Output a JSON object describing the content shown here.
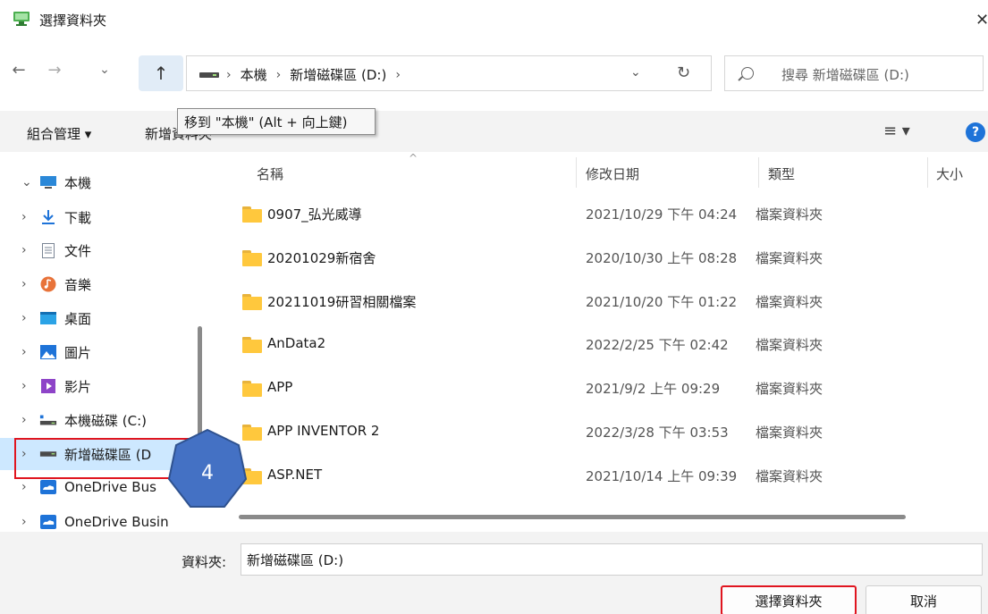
{
  "window": {
    "title": "選擇資料夾",
    "close": "✕"
  },
  "nav": {
    "back": "←",
    "forward": "→",
    "recent": "⌄",
    "up": "↑",
    "breadcrumb": [
      "本機",
      "新增磁碟區 (D:)"
    ],
    "refresh": "↻",
    "search_placeholder": "搜尋 新增磁碟區 (D:)"
  },
  "toolbar": {
    "organize": "組合管理 ▾",
    "new_folder": "新增資料夾",
    "view": "≡ ▾",
    "help": "?"
  },
  "tooltip": "移到 \"本機\" (Alt + 向上鍵)",
  "sidebar": {
    "items": [
      {
        "label": "本機",
        "chevron": "⌄",
        "icon": "computer-icon"
      },
      {
        "label": "下載",
        "chevron": "›",
        "icon": "download-icon"
      },
      {
        "label": "文件",
        "chevron": "›",
        "icon": "document-icon"
      },
      {
        "label": "音樂",
        "chevron": "›",
        "icon": "music-icon"
      },
      {
        "label": "桌面",
        "chevron": "›",
        "icon": "desktop-icon"
      },
      {
        "label": "圖片",
        "chevron": "›",
        "icon": "pictures-icon"
      },
      {
        "label": "影片",
        "chevron": "›",
        "icon": "video-icon"
      },
      {
        "label": "本機磁碟 (C:)",
        "chevron": "›",
        "icon": "drive-c-icon"
      },
      {
        "label": "新增磁碟區 (D",
        "chevron": "›",
        "icon": "drive-d-icon"
      },
      {
        "label": "OneDrive Bus",
        "chevron": "›",
        "icon": "onedrive-icon"
      },
      {
        "label": "OneDrive Busin",
        "chevron": "›",
        "icon": "onedrive-icon"
      }
    ]
  },
  "columns": {
    "name": "名稱",
    "date": "修改日期",
    "type": "類型",
    "size": "大小",
    "sort": "^"
  },
  "rows": [
    {
      "name": "0907_弘光威導",
      "date": "2021/10/29 下午 04:24",
      "type": "檔案資料夾"
    },
    {
      "name": "20201029新宿舍",
      "date": "2020/10/30 上午 08:28",
      "type": "檔案資料夾"
    },
    {
      "name": "20211019研習相關檔案",
      "date": "2021/10/20 下午 01:22",
      "type": "檔案資料夾"
    },
    {
      "name": "AnData2",
      "date": "2022/2/25 下午 02:42",
      "type": "檔案資料夾"
    },
    {
      "name": "APP",
      "date": "2021/9/2 上午 09:29",
      "type": "檔案資料夾"
    },
    {
      "name": "APP INVENTOR 2",
      "date": "2022/3/28 下午 03:53",
      "type": "檔案資料夾"
    },
    {
      "name": "ASP.NET",
      "date": "2021/10/14 上午 09:39",
      "type": "檔案資料夾"
    }
  ],
  "footer": {
    "folder_label": "資料夾:",
    "folder_value": "新增磁碟區 (D:)",
    "select_button": "選擇資料夾",
    "cancel_button": "取消"
  },
  "annotation": {
    "step": "4"
  }
}
